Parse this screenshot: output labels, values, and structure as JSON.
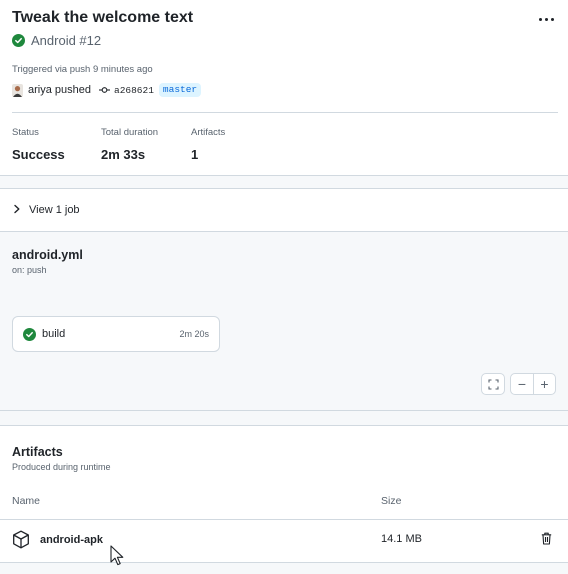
{
  "run": {
    "title": "Tweak the welcome text",
    "workflow_run": "Android #12",
    "triggered": "Triggered via push 9 minutes ago",
    "actor": "ariya pushed",
    "commit_sha": "a268621",
    "branch": "master",
    "menu_icon": "kebab-horizontal-icon",
    "status_icon": "check-circle-icon"
  },
  "stats": {
    "status_label": "Status",
    "status_value": "Success",
    "duration_label": "Total duration",
    "duration_value": "2m 33s",
    "artifacts_label": "Artifacts",
    "artifacts_value": "1"
  },
  "jobs_toggle": {
    "label": "View 1 job",
    "icon": "chevron-right-icon"
  },
  "workflow": {
    "file": "android.yml",
    "trigger": "on: push",
    "job": {
      "name": "build",
      "duration": "2m 20s",
      "status": "success"
    },
    "controls": {
      "fullscreen_icon": "screen-full-icon",
      "zoom_out": "−",
      "zoom_in": "+"
    }
  },
  "artifacts": {
    "title": "Artifacts",
    "subtitle": "Produced during runtime",
    "columns": {
      "name": "Name",
      "size": "Size"
    },
    "items": [
      {
        "name": "android-apk",
        "size": "14.1 MB",
        "icon": "package-icon",
        "action_icon": "trash-icon"
      }
    ]
  },
  "colors": {
    "success": "#1f883d",
    "link": "#0969da",
    "branch_bg": "#ddf4ff",
    "muted": "#59636e",
    "border": "#d1d9e0",
    "canvas": "#f6f8fa"
  }
}
